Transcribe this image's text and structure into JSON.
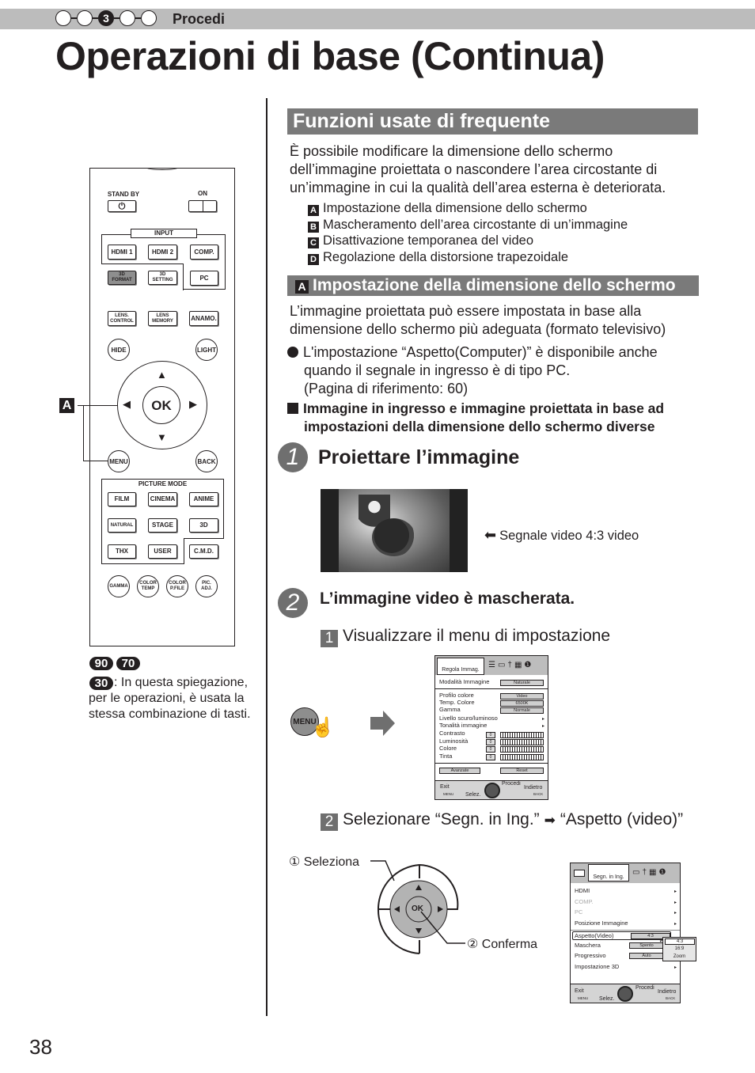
{
  "header": {
    "steps": [
      "",
      "",
      "3",
      "",
      ""
    ],
    "active_step": 3,
    "breadcrumb": "Procedi",
    "title": "Operazioni di base (Continua)"
  },
  "remote": {
    "standby": "STAND BY",
    "on": "ON",
    "input_title": "INPUT",
    "hdmi1": "HDMI 1",
    "hdmi2": "HDMI 2",
    "comp": "COMP.",
    "format3d_1": "3D",
    "format3d_2": "FORMAT",
    "setting3d_1": "3D",
    "setting3d_2": "SETTING",
    "pc": "PC",
    "lens_control_1": "LENS.",
    "lens_control_2": "CONTROL",
    "lens_memory_1": "LENS",
    "lens_memory_2": "MEMORY",
    "anamo": "ANAMO.",
    "hide": "HIDE",
    "light": "LIGHT",
    "ok": "OK",
    "menu": "MENU",
    "back": "BACK",
    "picture_mode_title": "PICTURE MODE",
    "film": "FILM",
    "cinema": "CINEMA",
    "anime": "ANIME",
    "natural": "NATURAL",
    "stage": "STAGE",
    "three_d": "3D",
    "thx": "THX",
    "user": "USER",
    "cmd": "C.M.D.",
    "gamma": "GAMMA",
    "color_temp_1": "COLOR",
    "color_temp_2": "TEMP",
    "color_pfile_1": "COLOR",
    "color_pfile_2": "P.FILE",
    "pic_adj_1": "PIC.",
    "pic_adj_2": "ADJ."
  },
  "callout_tag": "A",
  "models": {
    "badges": [
      "90",
      "70",
      "30"
    ],
    "note": ": In questa spiegazione, per le operazioni, è usata la stessa combinazione di tasti."
  },
  "section": {
    "title": "Funzioni usate di frequente",
    "intro": "È possibile modificare la dimensione dello schermo dell’immagine proiettata o nascondere l’area circostante di un’immagine in cui la qualità dell’area esterna è deteriorata.",
    "items": [
      {
        "letter": "A",
        "text": "Impostazione della dimensione dello schermo"
      },
      {
        "letter": "B",
        "text": "Mascheramento dell’area circostante di un’immagine"
      },
      {
        "letter": "C",
        "text": "Disattivazione temporanea del video"
      },
      {
        "letter": "D",
        "text": "Regolazione della distorsione trapezoidale"
      }
    ]
  },
  "subsection": {
    "letter": "A",
    "title": "Impostazione della dimensione dello schermo",
    "intro": "L’immagine proiettata può essere impostata in base alla dimensione dello schermo più adeguata (formato televisivo)",
    "bullet_1": "L'impostazione “Aspetto(Computer)” è disponibile anche",
    "bullet_2": "quando il segnale in ingresso è di tipo PC.",
    "bullet_3": "(Pagina di riferimento: 60)",
    "bold_1": "Immagine in ingresso e immagine proiettata in base ad",
    "bold_2": "impostazioni della dimensione dello schermo diverse"
  },
  "step1": {
    "number": "1",
    "title": "Proiettare l’immagine",
    "caption": "Segnale video 4:3 video"
  },
  "step2": {
    "number": "2",
    "title": "L’immagine video è mascherata.",
    "sub1_num": "1",
    "sub1": "Visualizzare il menu di impostazione",
    "menu_button": "MENU",
    "sub2_num": "2",
    "sub2_a": "Selezionare “Segn. in Ing.”",
    "sub2_b": "“Aspetto (video)”",
    "select_label": "① Seleziona",
    "confirm_label": "② Conferma",
    "ok": "OK"
  },
  "osd1": {
    "tab": "Regola Immag.",
    "rows": [
      {
        "label": "Modalità Immagine",
        "value": "Naturale"
      },
      {
        "label": "Profilo colore",
        "value": "Video"
      },
      {
        "label": "Temp. Colore",
        "value": "6500K"
      },
      {
        "label": "Gamma",
        "value": "Normale"
      },
      {
        "label": "Livello scuro/luminoso",
        "value": ""
      },
      {
        "label": "Tonalità immagine",
        "value": ""
      },
      {
        "label": "Contrasto",
        "value": "0"
      },
      {
        "label": "Luminosità",
        "value": "0"
      },
      {
        "label": "Colore",
        "value": "0"
      },
      {
        "label": "Tinta",
        "value": "0"
      }
    ],
    "advanced": "Avanzate",
    "reset": "Reset",
    "exit": "Exit",
    "menu": "MENU",
    "select": "Selez.",
    "proceed": "Procedi",
    "back": "Indietro",
    "back_key": "BACK"
  },
  "osd2": {
    "tab": "Segn. in Ing.",
    "rows": [
      {
        "label": "HDMI",
        "value": "",
        "disabled": false
      },
      {
        "label": "COMP.",
        "value": "",
        "disabled": true
      },
      {
        "label": "PC",
        "value": "",
        "disabled": true
      },
      {
        "label": "Posizione Immagine",
        "value": "",
        "disabled": false
      },
      {
        "label": "Aspetto(Video)",
        "value": "4:3",
        "disabled": false
      },
      {
        "label": "Maschera",
        "value": "Spento",
        "disabled": false
      },
      {
        "label": "Progressivo",
        "value": "Auto",
        "disabled": false
      },
      {
        "label": "Impostazione 3D",
        "value": "",
        "disabled": false
      }
    ],
    "dropdown": [
      "4:3",
      "16:9",
      "Zoom"
    ],
    "dropdown_selected": "4:3",
    "exit": "Exit",
    "menu": "MENU",
    "select": "Selez.",
    "proceed": "Procedi",
    "back": "Indietro",
    "back_key": "BACK"
  },
  "page_number": "38"
}
